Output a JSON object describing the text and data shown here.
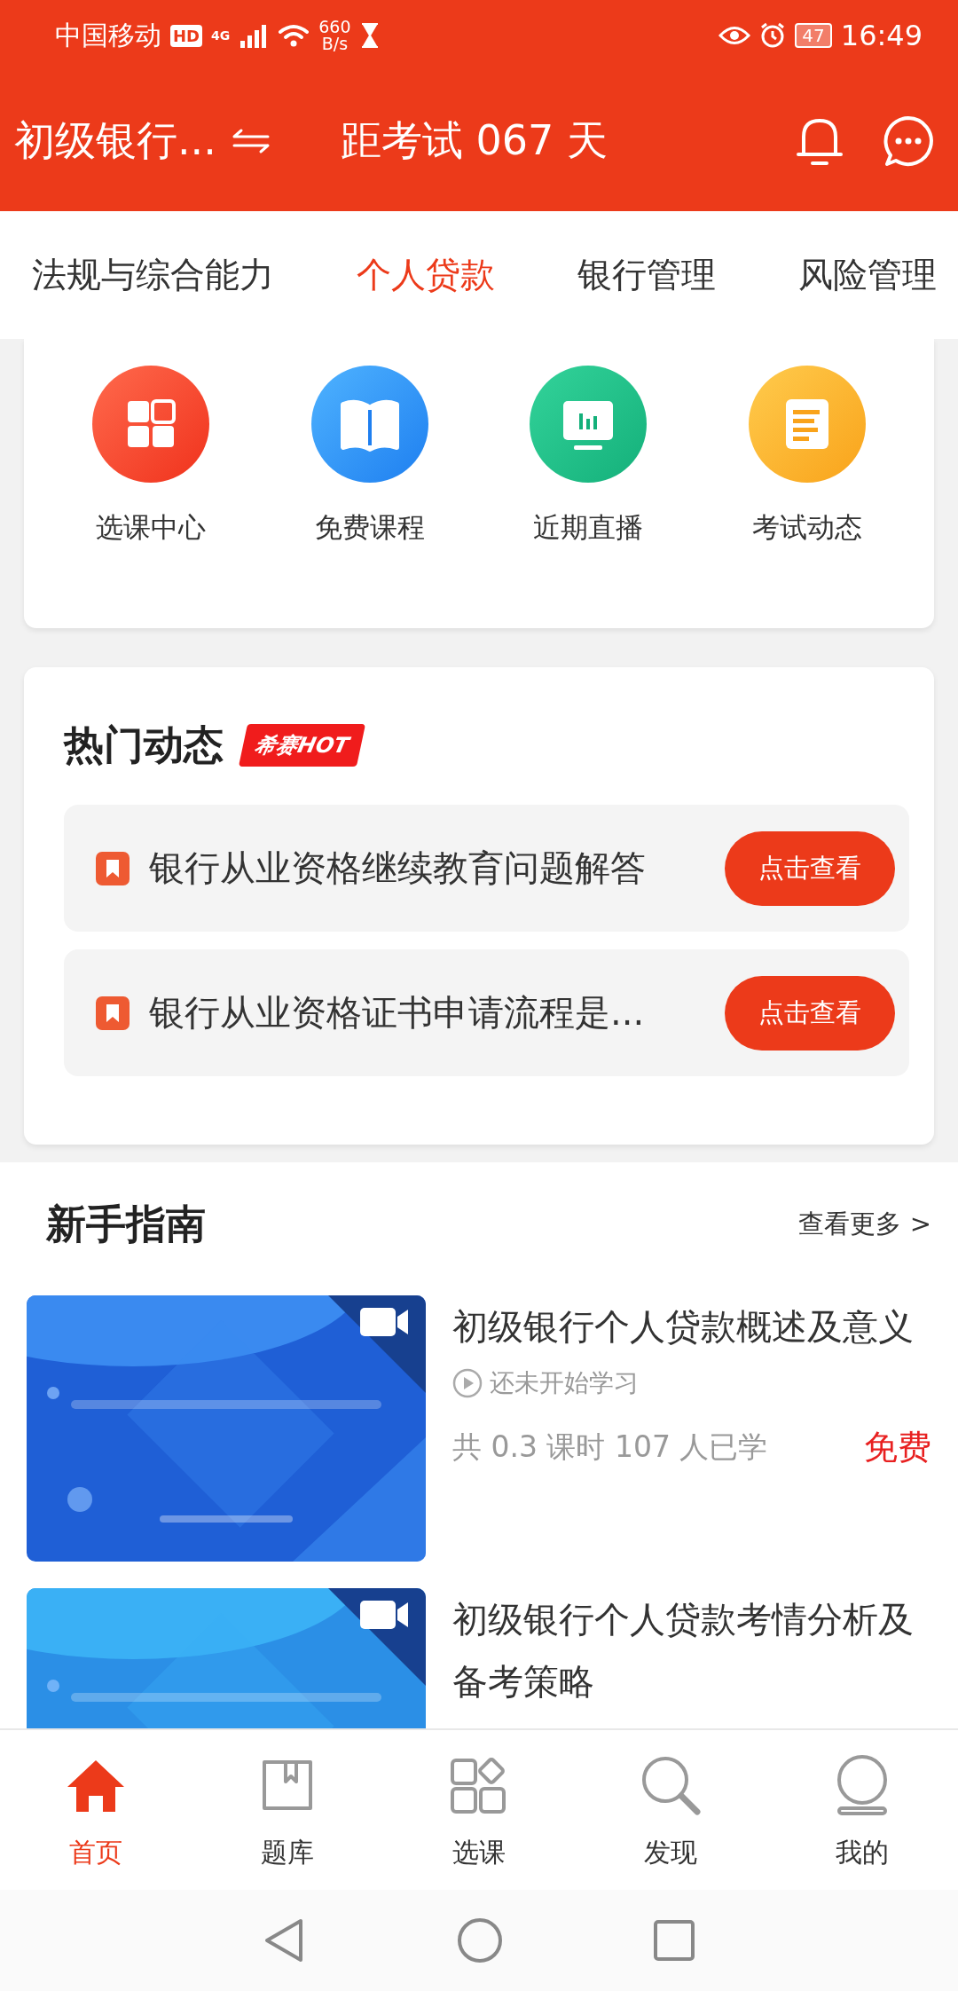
{
  "status_bar": {
    "carrier": "中国移动",
    "hd": "HD",
    "network": "4G",
    "speed": "660",
    "speed_unit": "B/s",
    "battery": "47",
    "time": "16:49"
  },
  "header": {
    "subject": "初级银行...",
    "countdown": "距考试 067 天"
  },
  "subject_tabs": [
    {
      "label": "法规与综合能力",
      "selected": false
    },
    {
      "label": "个人贷款",
      "selected": true
    },
    {
      "label": "银行管理",
      "selected": false
    },
    {
      "label": "风险管理",
      "selected": false
    }
  ],
  "quick_links": [
    {
      "label": "选课中心"
    },
    {
      "label": "免费课程"
    },
    {
      "label": "近期直播"
    },
    {
      "label": "考试动态"
    }
  ],
  "hot_news": {
    "title": "热门动态",
    "badge": "希赛HOT",
    "items": [
      {
        "text": "银行从业资格继续教育问题解答",
        "button": "点击查看"
      },
      {
        "text": "银行从业资格证书申请流程是...",
        "button": "点击查看"
      }
    ]
  },
  "guide": {
    "title": "新手指南",
    "more": "查看更多 >",
    "courses": [
      {
        "title": "初级银行个人贷款概述及意义",
        "status": "还未开始学习",
        "meta": "共 0.3 课时 107 人已学",
        "price": "免费"
      },
      {
        "title": "初级银行个人贷款考情分析及备考策略"
      }
    ]
  },
  "bottom_nav": [
    {
      "label": "首页",
      "selected": true
    },
    {
      "label": "题库",
      "selected": false
    },
    {
      "label": "选课",
      "selected": false
    },
    {
      "label": "发现",
      "selected": false
    },
    {
      "label": "我的",
      "selected": false
    }
  ]
}
